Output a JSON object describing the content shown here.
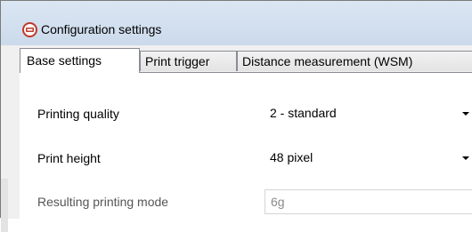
{
  "window": {
    "title": "Configuration settings",
    "icon": "app-logo-icon"
  },
  "tabs": [
    {
      "label": "Base settings",
      "active": true
    },
    {
      "label": "Print trigger",
      "active": false
    },
    {
      "label": "Distance measurement (WSM)",
      "active": false
    }
  ],
  "settings": {
    "printing_quality": {
      "label": "Printing quality",
      "value": "2 - standard"
    },
    "print_height": {
      "label": "Print height",
      "value": "48 pixel"
    },
    "resulting_mode": {
      "label": "Resulting printing mode",
      "value": "6g"
    }
  }
}
